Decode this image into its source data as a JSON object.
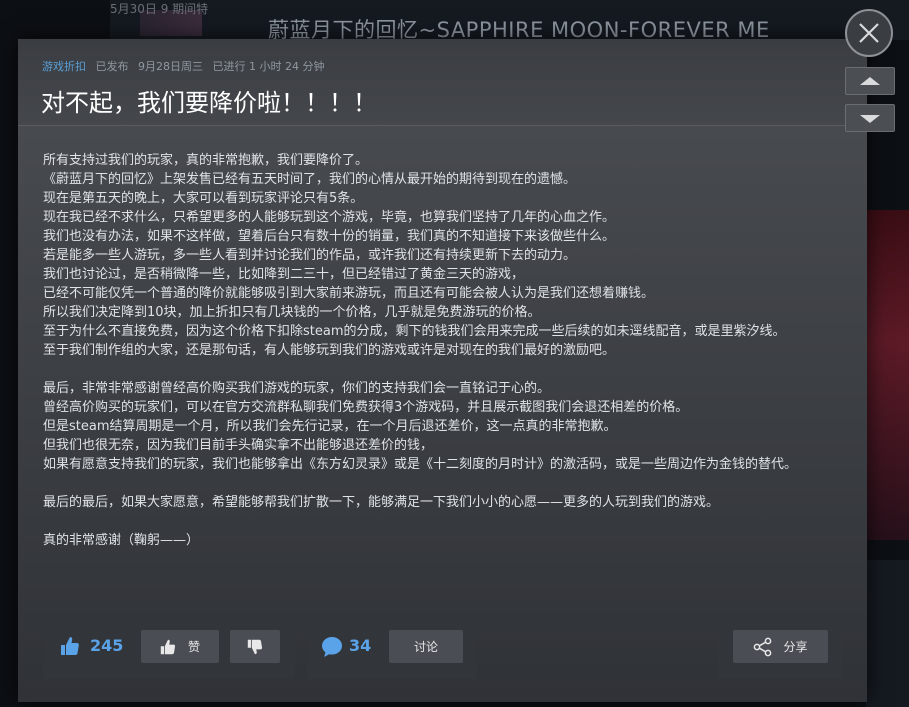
{
  "background": {
    "title": "蔚蓝月下的回忆~SAPPHIRE MOON-FOREVER ME",
    "top_snippet": "5月30日 9 期间特"
  },
  "modal": {
    "category": "游戏折扣",
    "status": "已发布",
    "date": "9月28日周三",
    "duration": "已进行 1 小时 24 分钟",
    "title": "对不起，我们要降价啦！！！！",
    "paragraphs": [
      "所有支持过我们的玩家，真的非常抱歉，我们要降价了。",
      "《蔚蓝月下的回忆》上架发售已经有五天时间了，我们的心情从最开始的期待到现在的遗憾。",
      "现在是第五天的晚上，大家可以看到玩家评论只有5条。",
      "现在我已经不求什么，只希望更多的人能够玩到这个游戏，毕竟，也算我们坚持了几年的心血之作。",
      "我们也没有办法，如果不这样做，望着后台只有数十份的销量，我们真的不知道接下来该做些什么。",
      "若是能多一些人游玩，多一些人看到并讨论我们的作品，或许我们还有持续更新下去的动力。",
      "我们也讨论过，是否稍微降一些，比如降到二三十，但已经错过了黄金三天的游戏，",
      "已经不可能仅凭一个普通的降价就能够吸引到大家前来游玩，而且还有可能会被人认为是我们还想着赚钱。",
      "所以我们决定降到10块，加上折扣只有几块钱的一个价格，几乎就是免费游玩的价格。",
      "至于为什么不直接免费，因为这个价格下扣除steam的分成，剩下的钱我们会用来完成一些后续的如未逕线配音，或是里紫汐线。",
      "至于我们制作组的大家，还是那句话，有人能够玩到我们的游戏或许是对现在的我们最好的激励吧。",
      "",
      "最后，非常非常感谢曾经高价购买我们游戏的玩家，你们的支持我们会一直铭记于心的。",
      "曾经高价购买的玩家们，可以在官方交流群私聊我们免费获得3个游戏码，并且展示截图我们会退还相差的价格。",
      "但是steam结算周期是一个月，所以我们会先行记录，在一个月后退还差价，这一点真的非常抱歉。",
      "但我们也很无奈，因为我们目前手头确实拿不出能够退还差价的钱，",
      "如果有愿意支持我们的玩家，我们也能够拿出《东方幻灵录》或是《十二刻度的月时计》的激活码，或是一些周边作为金钱的替代。",
      "",
      "最后的最后，如果大家愿意，希望能够帮我们扩散一下，能够满足一下我们小小的心愿——更多的人玩到我们的游戏。",
      "",
      "真的非常感谢（鞠躬——）"
    ]
  },
  "footer": {
    "like_count": "245",
    "like_label": "赞",
    "comment_count": "34",
    "discuss_label": "讨论",
    "share_label": "分享"
  },
  "colors": {
    "accent": "#5aa3e8",
    "category": "#5a9fd6"
  }
}
